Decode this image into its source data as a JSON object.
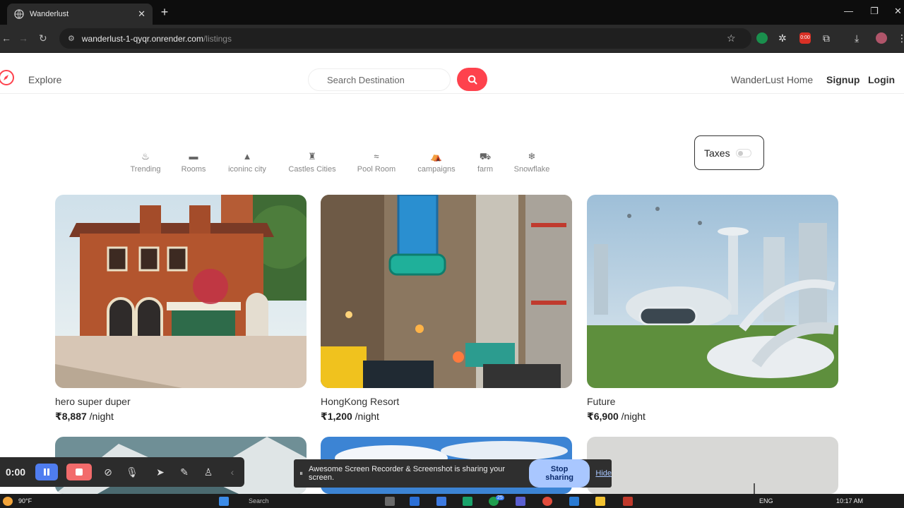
{
  "browser": {
    "tab_title": "Wanderlust",
    "url_host": "wanderlust-1-qyqr.onrender.com",
    "url_path": "/listings",
    "record_badge": "0:00"
  },
  "header": {
    "explore": "Explore",
    "search_placeholder": "Search Destination",
    "home_link": "WanderLust Home",
    "signup": "Signup",
    "login": "Login"
  },
  "filters": [
    {
      "label": "Trending",
      "icon": "fire-icon"
    },
    {
      "label": "Rooms",
      "icon": "bed-icon"
    },
    {
      "label": "iconinc city",
      "icon": "city-icon"
    },
    {
      "label": "Castles Cities",
      "icon": "castle-icon"
    },
    {
      "label": "Pool Room",
      "icon": "pool-icon"
    },
    {
      "label": "campaigns",
      "icon": "campground-icon"
    },
    {
      "label": "farm",
      "icon": "tractor-icon"
    },
    {
      "label": "Snowflake",
      "icon": "snowflake-icon"
    }
  ],
  "taxes_label": "Taxes",
  "listings": [
    {
      "title": "hero super duper",
      "price": "₹8,887",
      "per": " /night"
    },
    {
      "title": "HongKong Resort",
      "price": "₹1,200",
      "per": " /night"
    },
    {
      "title": "Future",
      "price": "₹6,900",
      "per": " /night"
    }
  ],
  "recorder": {
    "time": "0:00",
    "share_text": "Awesome Screen Recorder & Screenshot is sharing your screen.",
    "stop": "Stop sharing",
    "hide": "Hide"
  },
  "taskbar": {
    "weather": "90°F",
    "search": "Search",
    "lang": "ENG",
    "time": "10:17 AM",
    "badge": "25"
  },
  "colors": {
    "brand": "#fe424d",
    "chrome_dark": "#0d0d0d",
    "stop_button": "#a9c7ff"
  }
}
